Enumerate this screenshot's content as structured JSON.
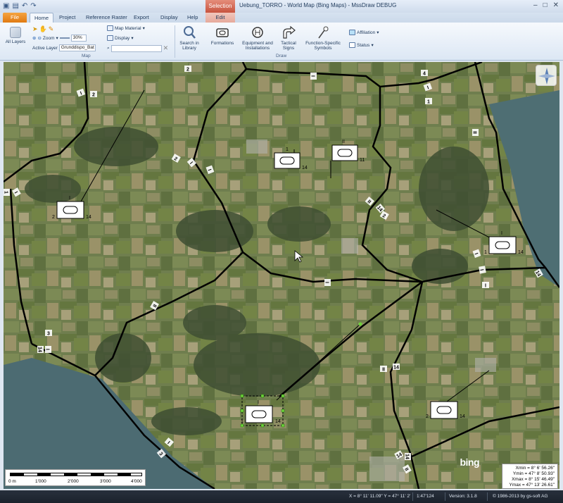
{
  "window": {
    "title": "Uebung_TORRO - World Map (Bing Maps) - MssDraw DEBUG",
    "context_tab_group": "Selection"
  },
  "tabs": [
    "File",
    "Home",
    "Project",
    "Reference Raster",
    "Export",
    "Display",
    "Help",
    "Edit"
  ],
  "ribbon": {
    "map_group": {
      "label": "Map",
      "all_layers": "All Layers",
      "zoom_label": "Zoom",
      "zoom_value": "30%",
      "active_layer_label": "Active Layer",
      "active_layer_value": "Grunddispo_Bat",
      "map_material": "Map Material",
      "display": "Display"
    },
    "draw_group": {
      "label": "Draw",
      "search_library": "Search in Library",
      "formations": "Formations",
      "equipment": "Equipment and Installations",
      "tactical_signs": "Tactical Signs",
      "function_symbols": "Function-Specific Symbols",
      "affiliation": "Affiliation",
      "status": "Status"
    }
  },
  "map": {
    "units": [
      {
        "size": "1",
        "left_label": "",
        "right_label": "14",
        "id": "u1"
      },
      {
        "size": "II",
        "left_label": "",
        "right_label": "11",
        "id": "u2"
      },
      {
        "size": "I",
        "left_label": "2",
        "right_label": "14",
        "id": "u3"
      },
      {
        "size": "I",
        "left_label": "1",
        "right_label": "14",
        "id": "u4"
      },
      {
        "size": "I",
        "left_label": "1",
        "right_label": "14",
        "id": "u5"
      },
      {
        "size": "",
        "left_label": "2",
        "right_label": "14",
        "id": "u6"
      }
    ],
    "boundary_labels": [
      "2",
      "I",
      "2",
      "I",
      "4",
      "I",
      "1",
      "II",
      "2",
      "I",
      "I",
      "1",
      "I",
      "II",
      "14",
      "2",
      "I",
      "I",
      "I",
      "14",
      "3",
      "I",
      "II",
      "14",
      "I",
      "II",
      "14",
      "I",
      "3",
      "14",
      "II",
      "14"
    ],
    "scale_bar": {
      "ticks": [
        "0 m",
        "1'000",
        "2'000",
        "3'000",
        "4'000"
      ]
    },
    "bing_logo": "bing",
    "extent": {
      "xmin": "Xmin = 8° 6' 56.26\"",
      "ymin": "Ymin = 47° 8' 50.93\"",
      "xmax": "Xmax = 8° 15' 46.49\"",
      "ymax": "Ymax = 47° 13' 26.61\""
    }
  },
  "statusbar": {
    "coords": "X = 8° 11' 11.09\" Y = 47° 11' 2'",
    "scale": "1:47'124",
    "version": "Version: 3.1.8",
    "copyright": "© 1986-2013 by gs-soft AG"
  }
}
